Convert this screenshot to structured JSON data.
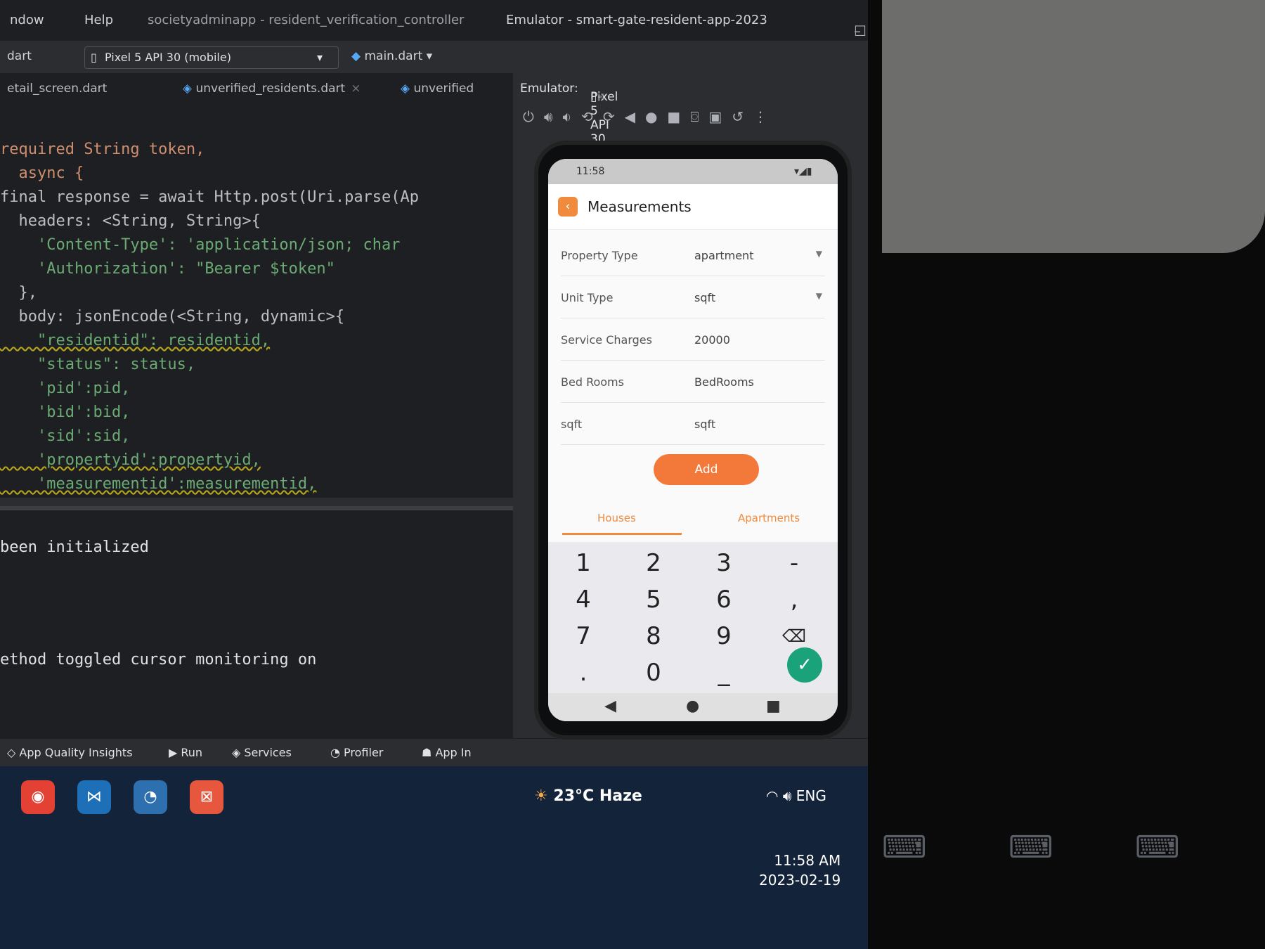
{
  "titlebar": {
    "menu_window": "ndow",
    "menu_help": "Help",
    "title": "societyadminapp - resident_verification_controller",
    "emulator_title": "Emulator - smart-gate-resident-app-2023"
  },
  "toolbar": {
    "left_file": "dart",
    "device_selector": "Pixel 5 API 30 (mobile)",
    "run_config": "main.dart",
    "unverified_label": "unverified"
  },
  "file_tabs": [
    {
      "label": "etail_screen.dart"
    },
    {
      "label": "unverified_residents.dart"
    }
  ],
  "code_lines": [
    "required String token,",
    "  async {",
    "final response = await Http.post(Uri.parse(Ap",
    "  headers: <String, String>{",
    "    'Content-Type': 'application/json; char",
    "    'Authorization': \"Bearer $token\"",
    "  },",
    "  body: jsonEncode(<String, dynamic>{",
    "    \"residentid\": residentid,",
    "    \"status\": status,",
    "    'pid':pid,",
    "    'bid':bid,",
    "    'sid':sid,",
    "    'propertyid':propertyid,",
    "    'measurementid':measurementid,",
    "  }));"
  ],
  "console": {
    "line1": "been initialized",
    "line2": "ethod toggled cursor monitoring on"
  },
  "tool_windows": {
    "app_quality": "App Quality Insights",
    "run": "Run",
    "services": "Services",
    "profiler": "Profiler",
    "app_inspection": "App In"
  },
  "emulator": {
    "label": "Emulator:",
    "device_tab": "Pixel 5 API 30"
  },
  "phone": {
    "status_time": "11:58",
    "screen_title": "Measurements",
    "fields": [
      {
        "label": "Property Type",
        "value": "apartment",
        "dropdown": true
      },
      {
        "label": "Unit Type",
        "value": "sqft",
        "dropdown": true
      },
      {
        "label": "Service Charges",
        "value": "20000",
        "dropdown": false
      },
      {
        "label": "Bed Rooms",
        "value": "BedRooms",
        "dropdown": false
      },
      {
        "label": "sqft",
        "value": "sqft",
        "dropdown": false
      }
    ],
    "add_button": "Add",
    "tab_houses": "Houses",
    "tab_apartments": "Apartments",
    "keys": [
      "1",
      "2",
      "3",
      "-",
      "4",
      "5",
      "6",
      ",",
      "7",
      "8",
      "9",
      "⌫",
      ".",
      "0",
      "_",
      "✓"
    ]
  },
  "taskbar": {
    "weather_temp": "23°C",
    "weather_desc": "Haze",
    "language": "ENG",
    "time": "11:58 AM",
    "date": "2023-02-19"
  },
  "colors": {
    "accent_orange": "#f2793a",
    "confirm_green": "#1aa37a",
    "ide_bg": "#1e1f22",
    "taskbar_bg": "#13233a"
  }
}
